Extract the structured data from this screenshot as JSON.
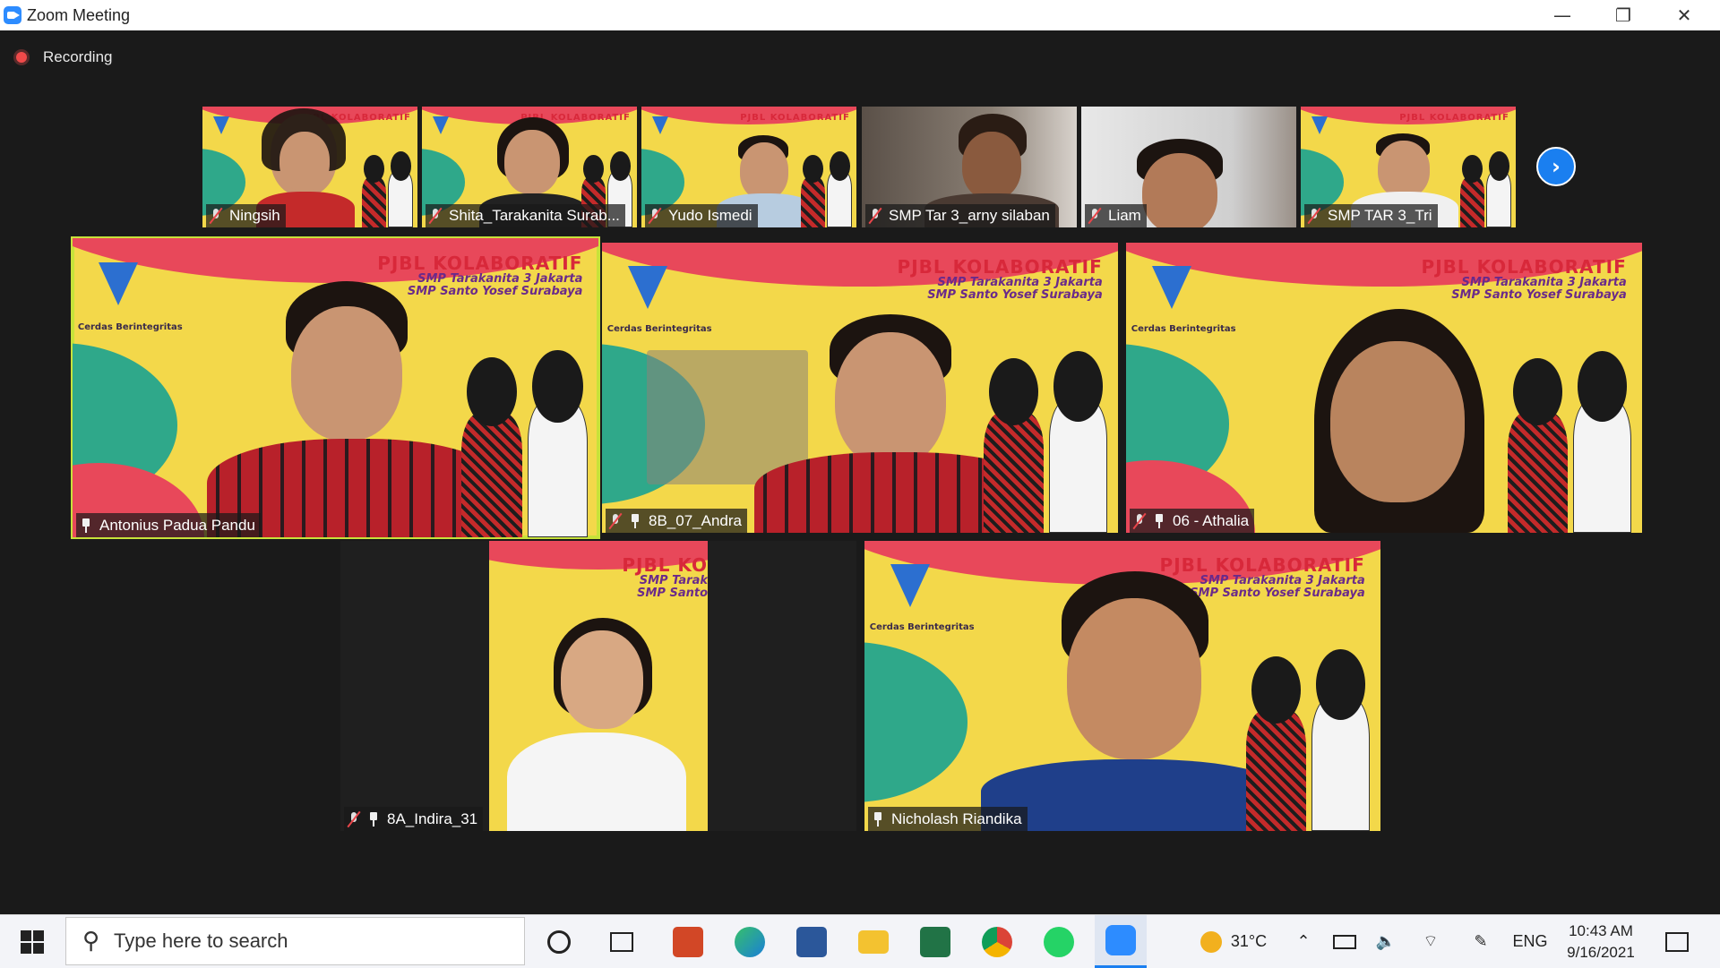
{
  "window": {
    "title": "Zoom Meeting",
    "minimize": "—",
    "restore": "❐",
    "close": "✕"
  },
  "recording": {
    "label": "Recording"
  },
  "banner": {
    "line1": "PJBL KOLABORATIF",
    "line2": "SMP Tarakanita 3 Jakarta",
    "line3": "SMP Santo Yosef Surabaya",
    "logo_text": "Cerdas Berintegritas"
  },
  "banner_partial": {
    "line1": "PJBL KO",
    "line2": "SMP Tarak",
    "line3": "SMP Santo"
  },
  "thumbnails": [
    {
      "name": "Ningsih"
    },
    {
      "name": "Shita_Tarakanita Surab..."
    },
    {
      "name": "Yudo Ismedi"
    },
    {
      "name": "SMP Tar 3_arny silaban"
    },
    {
      "name": "Liam"
    },
    {
      "name": "SMP TAR 3_Tri"
    }
  ],
  "participants": [
    {
      "name": "Antonius Padua Pandu"
    },
    {
      "name": "8B_07_Andra"
    },
    {
      "name": "06 - Athalia"
    },
    {
      "name": "8A_Indira_31"
    },
    {
      "name": "Nicholash Riandika"
    }
  ],
  "next_page": {
    "icon": "chevron-right-icon",
    "glyph": "›"
  },
  "taskbar": {
    "search_placeholder": "Type here to search",
    "weather": "31°C",
    "language": "ENG",
    "time": "10:43 AM",
    "date": "9/16/2021"
  },
  "colors": {
    "active_speaker": "#c7e23a",
    "accent": "#1a7ff0",
    "muted": "#e8454a"
  }
}
